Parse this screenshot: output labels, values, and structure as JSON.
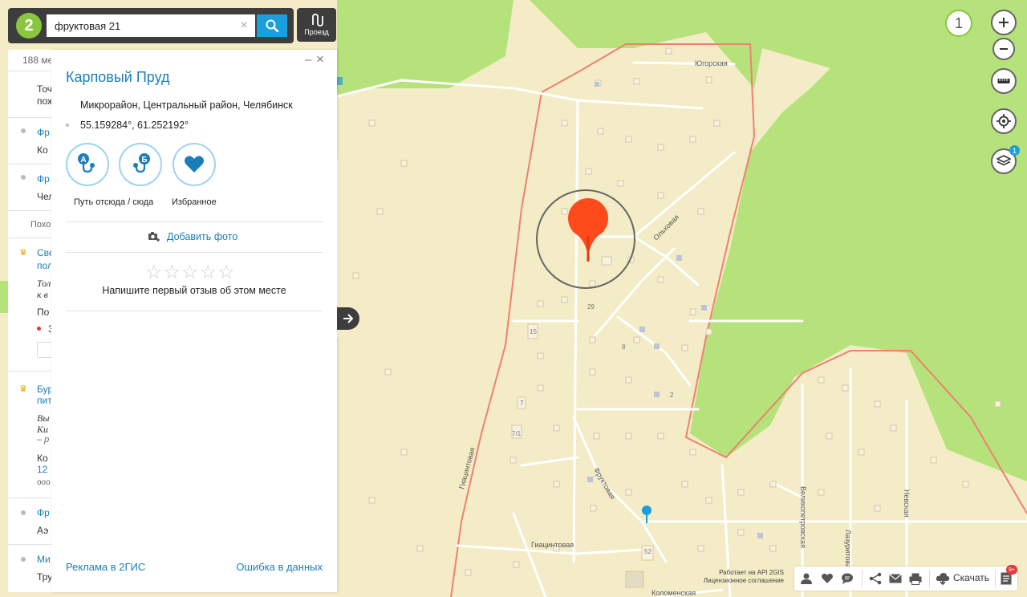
{
  "search": {
    "query": "фруктовая 21",
    "clear_label": "×"
  },
  "route_button": {
    "label": "Проезд"
  },
  "logo": {
    "text": "2"
  },
  "results_list": {
    "count_text": "188 ме",
    "rows": [
      {
        "text": "Точ",
        "style": "plain"
      },
      {
        "text": "пож",
        "style": "plain"
      },
      {
        "text": "Фр",
        "style": "link"
      },
      {
        "text": "Ко",
        "style": "plain"
      },
      {
        "text": "Фр",
        "style": "link"
      },
      {
        "text": "Чел",
        "style": "plain"
      },
      {
        "text": "Похо",
        "style": "grey"
      },
      {
        "text": "Све",
        "style": "link"
      },
      {
        "text": "пол",
        "style": "link"
      },
      {
        "text": "Тол",
        "style": "plain"
      },
      {
        "text": "к в",
        "style": "plain"
      },
      {
        "text": "По",
        "style": "plain"
      },
      {
        "text": "З",
        "style": "plain"
      },
      {
        "text": "Бур",
        "style": "link"
      },
      {
        "text": "пит",
        "style": "link"
      },
      {
        "text": "Вы",
        "style": "plain"
      },
      {
        "text": "Ки",
        "style": "plain"
      },
      {
        "text": "– р",
        "style": "grey"
      },
      {
        "text": "Ко",
        "style": "plain"
      },
      {
        "text": "12",
        "style": "link"
      },
      {
        "text": "ооо",
        "style": "grey"
      },
      {
        "text": "Фр",
        "style": "link"
      },
      {
        "text": "Аэ",
        "style": "plain"
      },
      {
        "text": "Ми",
        "style": "link"
      },
      {
        "text": "Тру",
        "style": "plain"
      }
    ]
  },
  "card": {
    "title": "Карповый Пруд",
    "address": "Микрорайон, Центральный район, Челябинск",
    "coordinates": "55.159284°, 61.252192°",
    "actions": [
      {
        "label": "Путь отсюда / сюда",
        "icon": "route-ab-icon"
      },
      {
        "label": "Избранное",
        "icon": "heart-icon"
      }
    ],
    "add_photo": "Добавить фото",
    "review_prompt": "Напишите первый отзыв об этом месте",
    "footer_left": "Реклама в 2ГИС",
    "footer_right": "Ошибка в данных",
    "minimize": "–",
    "close": "×"
  },
  "map": {
    "zoom_badge": "1",
    "layers_count": "1",
    "street_labels": [
      "Югорская",
      "Ольховая",
      "Фруктовая",
      "Гиацинтовая",
      "Гиацинтовая",
      "Великопетровская",
      "Лазуритовая",
      "Невская",
      "Коломенская"
    ],
    "house_numbers": [
      "29",
      "15",
      "8",
      "2",
      "7",
      "7/1",
      "52"
    ],
    "attribution_line1": "Работает на API 2GIS",
    "attribution_line2": "Лицензионное соглашение"
  },
  "toolbar": {
    "download_label": "Скачать",
    "notifications": "9+"
  },
  "colors": {
    "accent": "#1a9fdc",
    "link": "#1a7fb8",
    "brand_green": "#8bc63f",
    "pin": "#ff4a1c",
    "boundary": "#f08070",
    "forest": "#b5e27a",
    "land": "#f3ecc6"
  }
}
